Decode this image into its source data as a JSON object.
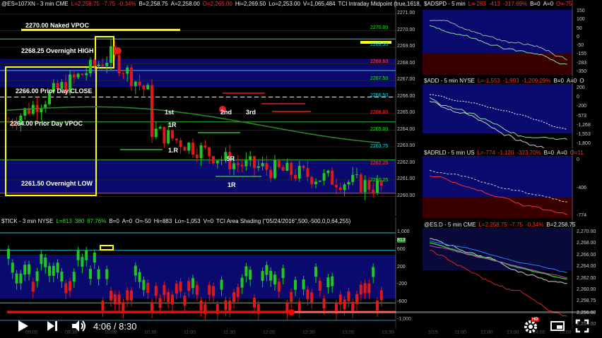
{
  "colors": {
    "bg": "#000000",
    "up": "#1ec81e",
    "down": "#e01818",
    "navy": "#0a0a6e",
    "yellow": "#ffff00",
    "cyan": "#20c0d0"
  },
  "main": {
    "header": {
      "symbol": "@ES=107XN - 3 min CME",
      "last": "L=2,258.75",
      "chg": "-7.75",
      "pct": "-0.34%",
      "bid": "B=2,258.75",
      "ask": "A=2,258.00",
      "open": "O=2,265.00",
      "hi": "Hi=2,269.50",
      "lo": "Lo=2,253.00",
      "vol": "V=1,065,484",
      "study": "TCI Intraday Midpoint (true,1618,0)"
    },
    "levels": [
      {
        "label": "2270.00 Naked VPOC"
      },
      {
        "label": "2268.25 Overnight HIGH"
      },
      {
        "label": "2266.00 Prior Day CLOSE"
      },
      {
        "label": "2264.00 Prior Day VPOC"
      },
      {
        "label": "2261.50 Overnight LOW"
      }
    ],
    "annotations": {
      "first": "1st",
      "second": "2nd",
      "third": "3rd",
      "r1a": "1R",
      "r1b": "1.R",
      "r5": ".5R",
      "r1c": "1R"
    },
    "price_axis": [
      "2271.00",
      "2270.00",
      "2269.00",
      "2268.00",
      "2267.00",
      "2266.00",
      "2265.00",
      "2264.00",
      "2263.00",
      "2262.00",
      "2261.00",
      "2260.00"
    ],
    "price_tags": [
      "2270.00",
      "2269.50",
      "2268.50",
      "2267.50",
      "2266.50",
      "2266.00",
      "2265.00",
      "2263.75",
      "2262.25",
      "2260.25"
    ]
  },
  "tick": {
    "header": {
      "symbol": "$TICK - 3 min NYSE",
      "last": "L=813",
      "chg": "380",
      "pct": "87.76%",
      "bid": "B=0",
      "ask": "A=0",
      "open": "O=-50",
      "hi": "Hi=883",
      "lo": "Lo=-1,053",
      "vol": "V=0",
      "study": "TCI Area Shading (\"05/24/2016\",500,-500,0,0,64,255)"
    },
    "axis": [
      "1,000",
      "813",
      "600",
      "200",
      "-200",
      "-600",
      "-1,000"
    ]
  },
  "time_axis": [
    "09:00",
    "09:30",
    "10:00",
    "10:30",
    "11:00",
    "11:30",
    "12:00",
    "12:30",
    "13:00",
    "13:30"
  ],
  "adspd": {
    "header": {
      "symbol": "$ADSPD - 5 min",
      "last": "L=-283",
      "chg": "-413",
      "pct": "-317.69%",
      "bid": "B=0",
      "ask": "A=0",
      "extra": "O=-75"
    },
    "axis": [
      "150",
      "100",
      "50",
      "0",
      "-50",
      "-155",
      "-283",
      "-350"
    ]
  },
  "add": {
    "header": {
      "symbol": "$ADD - 5 min NYSE",
      "last": "L=-1,553",
      "chg": "-1,693",
      "pct": "-1,209.29%",
      "bid": "B=0",
      "ask": "A=0",
      "extra": "O"
    },
    "axis": [
      "200",
      "0",
      "-200",
      "-573",
      "-1,268",
      "-1,553",
      "-1,800"
    ]
  },
  "adrld": {
    "header": {
      "symbol": "$ADRLD - 5 min US",
      "last": "L=-774",
      "chg": "-1,120",
      "pct": "-323.70%",
      "bid": "B=0",
      "ask": "A=0",
      "extra": "O=11"
    },
    "axis": [
      "0",
      "-406",
      "-774"
    ]
  },
  "es_d": {
    "header": {
      "symbol": "@ES.D - 5 min CME",
      "last": "L=2,258.75",
      "chg": "-7.75",
      "pct": "-0.34%",
      "bid": "B=2,258.75"
    },
    "axis": [
      "2,270.00",
      "2,268.00",
      "2,266.00",
      "2,264.00",
      "2,262.00",
      "2,260.00",
      "2,258.75",
      "2,256.00",
      "2,254.00"
    ],
    "tags": [
      "2,263.81",
      "2,259.98",
      "2,258.75",
      "2,257.68"
    ],
    "time_axis": [
      "1/19",
      "11:00",
      "12:00",
      "13:00",
      "14:00",
      "15:00"
    ]
  },
  "player": {
    "current": "4:06",
    "total": "8:30",
    "progress": 0.483,
    "hd": "HD"
  }
}
